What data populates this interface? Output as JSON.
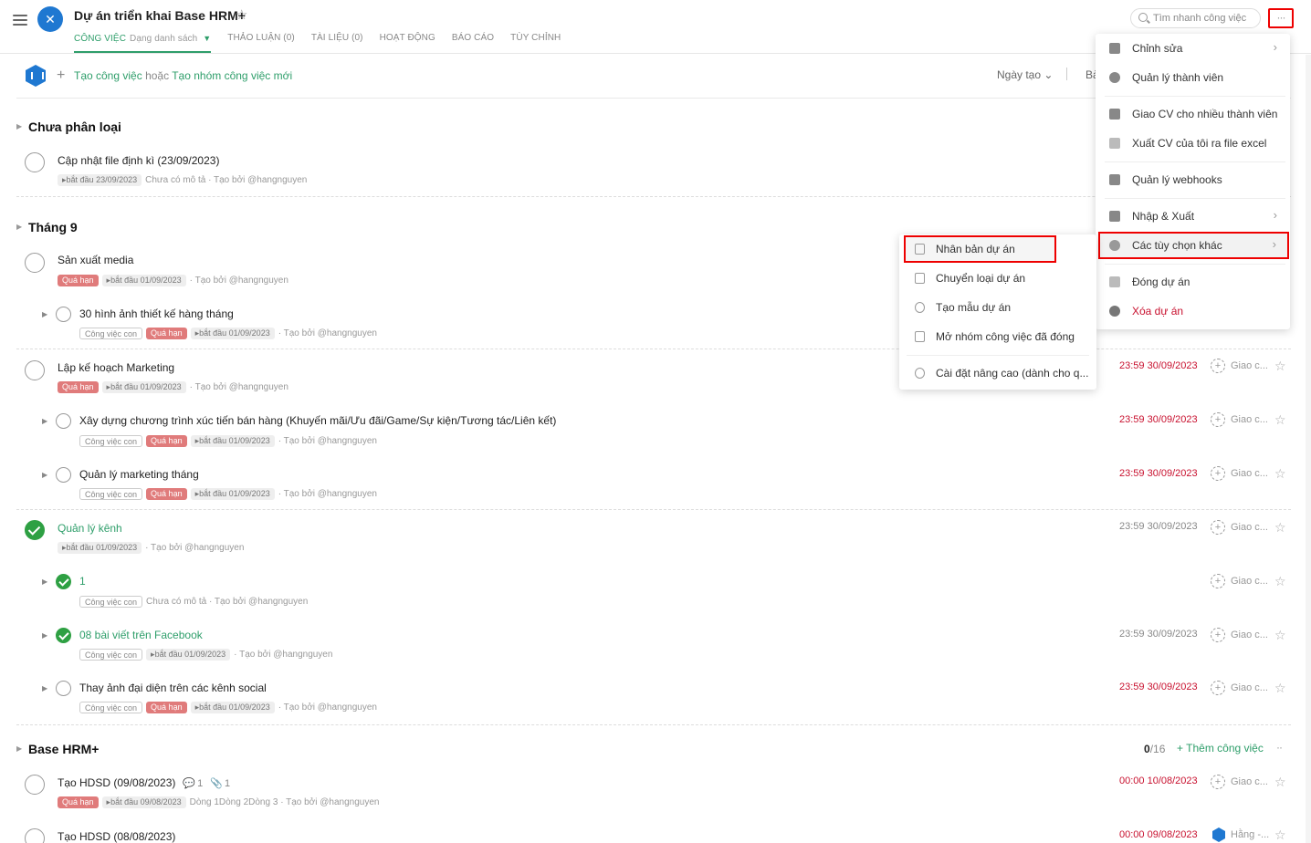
{
  "header": {
    "project_title": "Dự án triển khai Base HRM+",
    "tabs": [
      {
        "label": "Công việc",
        "sub": "Dạng danh sách"
      },
      {
        "label": "Thảo luận (0)"
      },
      {
        "label": "Tài liệu (0)"
      },
      {
        "label": "Hoạt động"
      },
      {
        "label": "Báo cáo"
      },
      {
        "label": "Tùy chỉnh"
      }
    ],
    "search_placeholder": "Tìm nhanh công việc",
    "more_label": "···"
  },
  "toolbar": {
    "create_task": "Tạo công việc",
    "or": "hoặc",
    "create_group": "Tạo nhóm công việc mới",
    "sort_label": "Ngày tạo",
    "sort_trunc": "Bả"
  },
  "sections": {
    "s1": {
      "title": "Chưa phân loại"
    },
    "s2": {
      "title": "Tháng 9"
    },
    "s3": {
      "title": "Base HRM+",
      "count_done": "0",
      "count_total": "/16",
      "add_label": "Thêm công việc"
    }
  },
  "labels": {
    "start": "bắt đầu",
    "overdue": "Quá hạn",
    "child": "Công việc con",
    "no_desc": "Chưa có mô tả",
    "created_by": "· Tạo bởi @hangnguyen",
    "assign": "Giao c...",
    "assign_user": "Hằng -..."
  },
  "tasks": [
    {
      "title": "Cập nhật file định kì (23/09/2023)",
      "start": "23/09/2023"
    },
    {
      "title": "Sản xuất media",
      "start": "01/09/2023"
    },
    {
      "title": "30 hình ảnh thiết kế hàng tháng",
      "start": "01/09/2023"
    },
    {
      "title": "Lập kế hoạch Marketing",
      "start": "01/09/2023",
      "due": "23:59 30/09/2023"
    },
    {
      "title": "Xây dựng chương trình xúc tiến bán hàng (Khuyến mãi/Ưu đãi/Game/Sự kiện/Tương tác/Liên kết)",
      "start": "01/09/2023",
      "due": "23:59 30/09/2023"
    },
    {
      "title": "Quản lý marketing tháng",
      "start": "01/09/2023",
      "due": "23:59 30/09/2023"
    },
    {
      "title": "Quản lý kênh",
      "start": "01/09/2023",
      "due": "23:59 30/09/2023"
    },
    {
      "title": "1"
    },
    {
      "title": "08 bài viết trên Facebook",
      "start": "01/09/2023",
      "due": "23:59 30/09/2023"
    },
    {
      "title": "Thay ảnh đại diện trên các kênh social",
      "start": "01/09/2023",
      "due": "23:59 30/09/2023"
    },
    {
      "title": "Tạo HDSD (09/08/2023)",
      "start": "09/08/2023",
      "due": "00:00 10/08/2023",
      "comments": "1",
      "attachments": "1",
      "desc": "Dòng 1Dòng 2Dòng 3"
    },
    {
      "title": "Tạo HDSD (08/08/2023)",
      "due": "00:00 09/08/2023"
    }
  ],
  "menu": {
    "items": [
      {
        "label": "Chỉnh sửa"
      },
      {
        "label": "Quản lý thành viên"
      },
      {
        "label": "Giao CV cho nhiều thành viên"
      },
      {
        "label": "Xuất CV của tôi ra file excel"
      },
      {
        "label": "Quản lý webhooks"
      },
      {
        "label": "Nhập & Xuất"
      },
      {
        "label": "Các tùy chọn khác"
      },
      {
        "label": "Đóng dự án"
      },
      {
        "label": "Xóa dự án"
      }
    ]
  },
  "submenu": {
    "items": [
      {
        "label": "Nhân bản dự án"
      },
      {
        "label": "Chuyển loại dự án"
      },
      {
        "label": "Tạo mẫu dự án"
      },
      {
        "label": "Mở nhóm công việc đã đóng"
      },
      {
        "label": "Cài đặt nâng cao (dành cho q..."
      }
    ]
  }
}
